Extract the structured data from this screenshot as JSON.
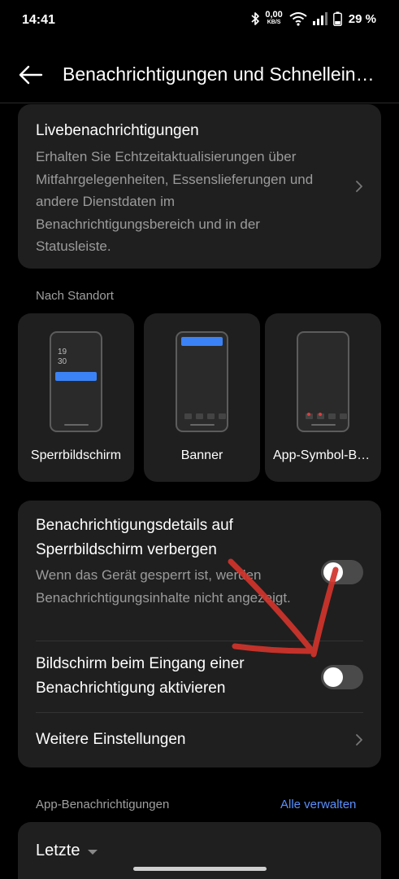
{
  "status_bar": {
    "time": "14:41",
    "net_speed": "0,00",
    "net_unit": "KB/S",
    "battery_pct": "29 %",
    "icons": [
      "bluetooth-icon",
      "wifi-icon",
      "signal-icon",
      "battery-icon"
    ]
  },
  "header": {
    "title": "Benachrichtigungen und Schnelleinstellungen",
    "back_icon": "arrow-left-icon"
  },
  "live": {
    "title": "Livebenachrichtigungen",
    "description": "Erhalten Sie Echtzeitaktualisierungen über Mitfahrgelegenheiten, Essenslieferungen und andere Dienstdaten im Benachrichtigungsbereich und in der Statusleiste."
  },
  "location": {
    "section_label": "Nach Standort",
    "tiles": [
      {
        "label": "Sperrbildschirm",
        "clock_hour": "19",
        "clock_min": "30"
      },
      {
        "label": "Banner"
      },
      {
        "label": "App-Symbol-Badges"
      }
    ]
  },
  "settings": {
    "hide_details": {
      "title": "Benachrichtigungsdetails auf Sperrbildschirm verbergen",
      "description": "Wenn das Gerät gesperrt ist, werden Benachrichtigungsinhalte nicht angezeigt.",
      "enabled": false
    },
    "wake_screen": {
      "title": "Bildschirm beim Eingang einer Benachrichtigung aktivieren",
      "enabled": false
    },
    "more_settings": {
      "title": "Weitere Einstellungen"
    }
  },
  "app_notifications": {
    "section_label": "App-Benachrichtigungen",
    "manage_all": "Alle verwalten",
    "sort_value": "Letzte"
  },
  "colors": {
    "background": "#000000",
    "card": "#1f1f1f",
    "accent": "#5b8ff9",
    "toggle_off": "#4a4a4a",
    "annotation": "#d0342c"
  }
}
